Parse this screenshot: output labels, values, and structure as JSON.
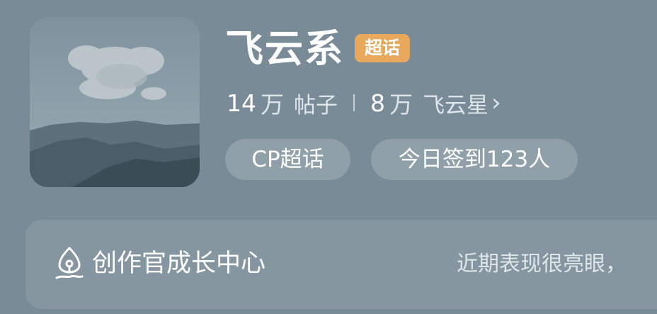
{
  "topic": {
    "name": "飞云系",
    "badge": "超话",
    "cover_image": "cloud-mountain-landscape"
  },
  "stats": {
    "posts": {
      "value": "14",
      "unit": "万",
      "label": "帖子"
    },
    "members": {
      "value": "8",
      "unit": "万",
      "label": "飞云星"
    }
  },
  "chips": [
    {
      "label": "CP超话"
    },
    {
      "label": "今日签到123人"
    }
  ],
  "creator_panel": {
    "title": "创作官成长中心",
    "description": "近期表现很亮眼，",
    "icon": "pen-nib-icon"
  },
  "colors": {
    "background": "#788b97",
    "badge": "#e9a95c",
    "chip_bg": "rgba(255,255,255,0.18)"
  }
}
